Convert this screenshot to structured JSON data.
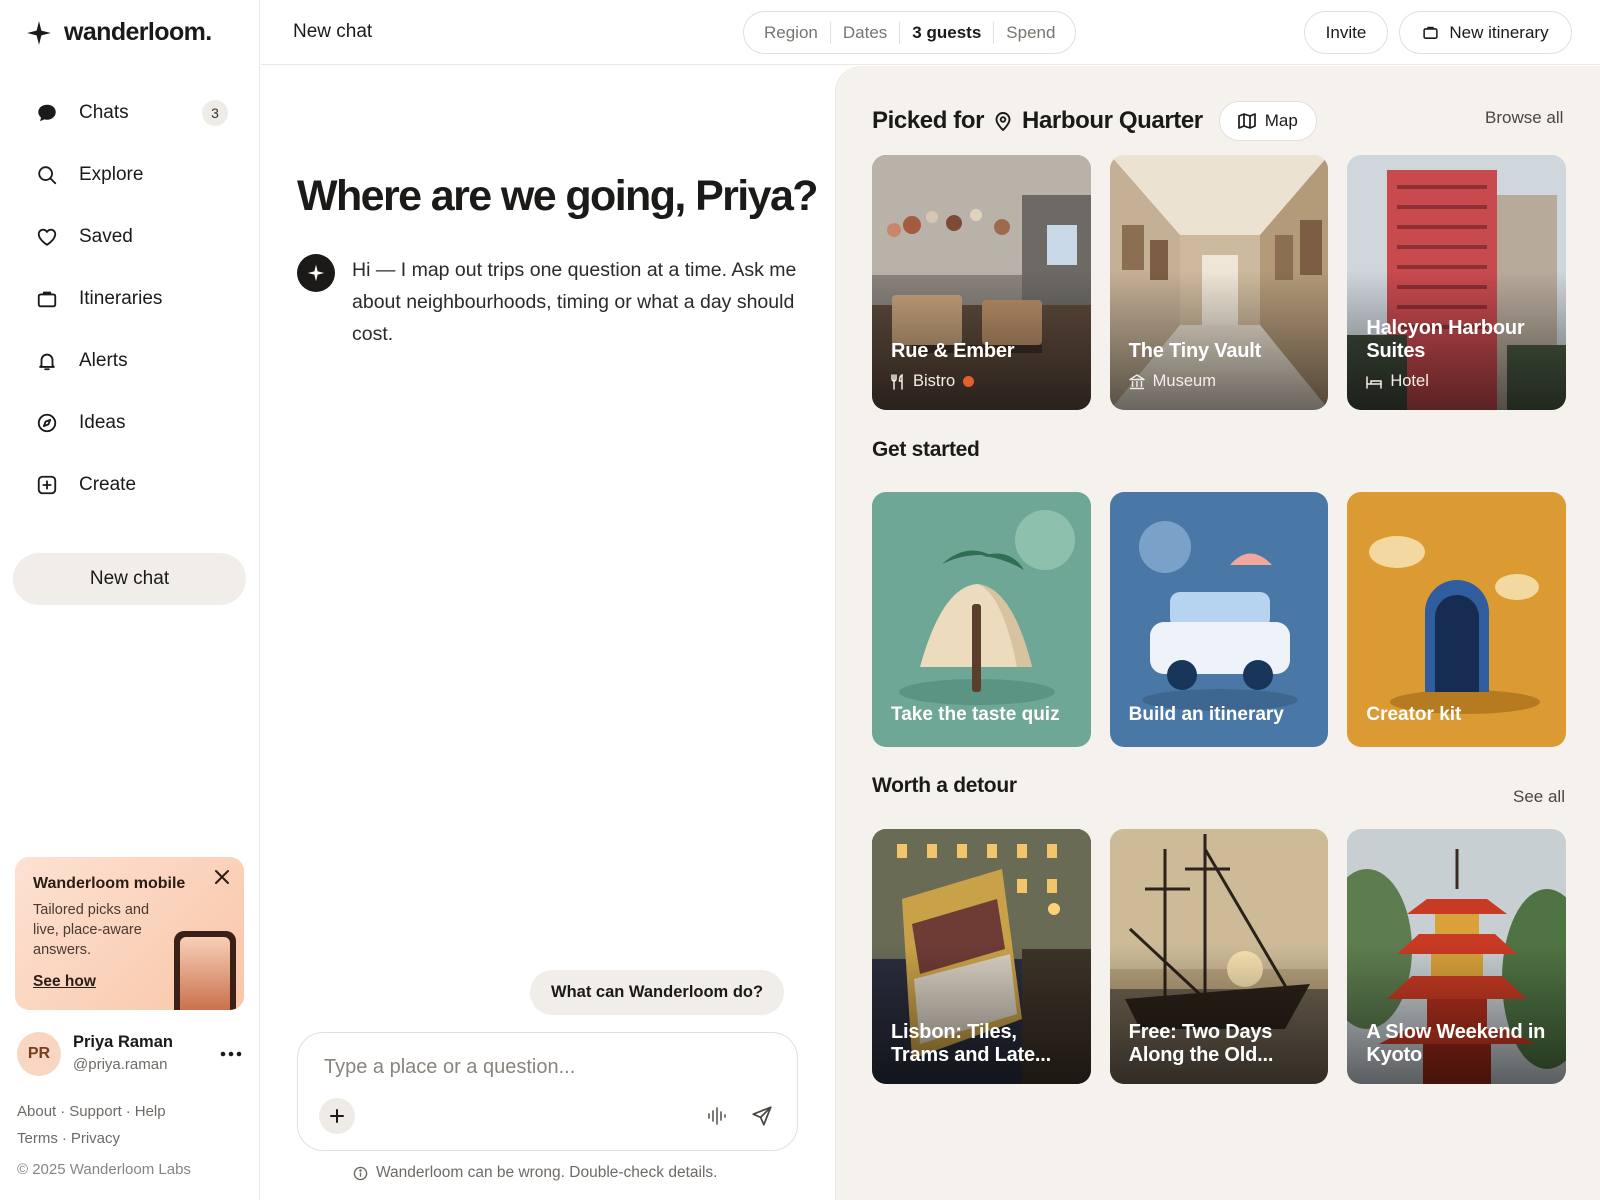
{
  "app": {
    "name": "wanderloom."
  },
  "sidebar": {
    "items": [
      {
        "label": "Chats",
        "icon": "chat-bubble-icon",
        "badge": "3"
      },
      {
        "label": "Explore",
        "icon": "search-icon"
      },
      {
        "label": "Saved",
        "icon": "heart-icon"
      },
      {
        "label": "Itineraries",
        "icon": "briefcase-icon"
      },
      {
        "label": "Alerts",
        "icon": "bell-icon"
      },
      {
        "label": "Ideas",
        "icon": "compass-icon"
      },
      {
        "label": "Create",
        "icon": "plus-square-icon"
      }
    ],
    "new_chat": "New chat",
    "promo": {
      "title": "Wanderloom mobile",
      "body": "Tailored picks and live, place-aware answers.",
      "link": "See how"
    },
    "user": {
      "initials": "PR",
      "name": "Priya Raman",
      "handle": "@priya.raman"
    },
    "footer": {
      "about": "About",
      "support": "Support",
      "help": "Help",
      "terms": "Terms",
      "privacy": "Privacy"
    },
    "copyright": "© 2025 Wanderloom Labs"
  },
  "topbar": {
    "title": "New chat",
    "filters": [
      "Region",
      "Dates",
      "3 guests",
      "Spend"
    ],
    "active_filter": "3 guests",
    "invite": "Invite",
    "new_itinerary": "New itinerary"
  },
  "chat": {
    "greeting": "Where are we going, Priya?",
    "assistant_message": "Hi — I map out trips one question at a time. Ask me about neighbourhoods, timing or what a day should cost.",
    "suggestion": "What can Wanderloom do?",
    "input_placeholder": "Type a place or a question...",
    "disclaimer": "Wanderloom can be wrong. Double-check details."
  },
  "panel": {
    "picked_label": "Picked for",
    "location": "Harbour Quarter",
    "map": "Map",
    "browse_all": "Browse all",
    "picks": [
      {
        "title": "Rue & Ember",
        "type": "Bistro",
        "icon": "utensils-icon"
      },
      {
        "title": "The Tiny Vault",
        "type": "Museum",
        "icon": "museum-icon"
      },
      {
        "title": "Halcyon Harbour Suites",
        "type": "Hotel",
        "icon": "bed-icon"
      }
    ],
    "get_started_title": "Get started",
    "get_started": [
      {
        "title": "Take the taste quiz",
        "color": "#6fa796"
      },
      {
        "title": "Build an itinerary",
        "color": "#4a78a6"
      },
      {
        "title": "Creator kit",
        "color": "#dc9b32"
      }
    ],
    "detour_title": "Worth a detour",
    "see_all": "See all",
    "detours": [
      {
        "title": "Lisbon: Tiles, Trams and Late..."
      },
      {
        "title": "Free: Two Days Along the Old..."
      },
      {
        "title": "A Slow Weekend in Kyoto"
      }
    ]
  },
  "colors": {
    "accent_dark": "#1c1a18",
    "panel_bg": "#f5f2ee",
    "pill_bg": "#f1eee9",
    "status_dot": "#e2602d"
  }
}
